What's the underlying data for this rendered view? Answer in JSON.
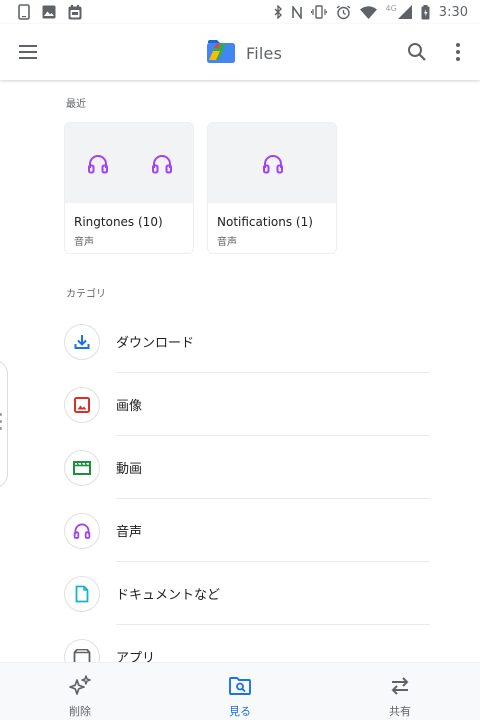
{
  "status_bar": {
    "time": "3:30",
    "network_label": "4G"
  },
  "app_bar": {
    "title": "Files"
  },
  "recent": {
    "header": "最近",
    "cards": [
      {
        "title": "Ringtones (10)",
        "subtitle": "音声"
      },
      {
        "title": "Notifications (1)",
        "subtitle": "音声"
      }
    ]
  },
  "categories": {
    "header": "カテゴリ",
    "items": [
      {
        "label": "ダウンロード",
        "icon": "download-icon"
      },
      {
        "label": "画像",
        "icon": "image-icon"
      },
      {
        "label": "動画",
        "icon": "video-icon"
      },
      {
        "label": "音声",
        "icon": "headphones-icon"
      },
      {
        "label": "ドキュメントなど",
        "icon": "document-icon"
      },
      {
        "label": "アプリ",
        "icon": "android-icon"
      }
    ]
  },
  "bottom_nav": {
    "items": [
      {
        "label": "削除",
        "icon": "sparkle-clean-icon",
        "active": false
      },
      {
        "label": "見る",
        "icon": "browse-folder-icon",
        "active": true
      },
      {
        "label": "共有",
        "icon": "swap-arrows-icon",
        "active": false
      }
    ]
  },
  "colors": {
    "accent": "#1a73e8",
    "audio_purple": "#a142f4",
    "image_red": "#d93025",
    "video_green": "#1e8e3e",
    "document_teal": "#12b5cb"
  }
}
